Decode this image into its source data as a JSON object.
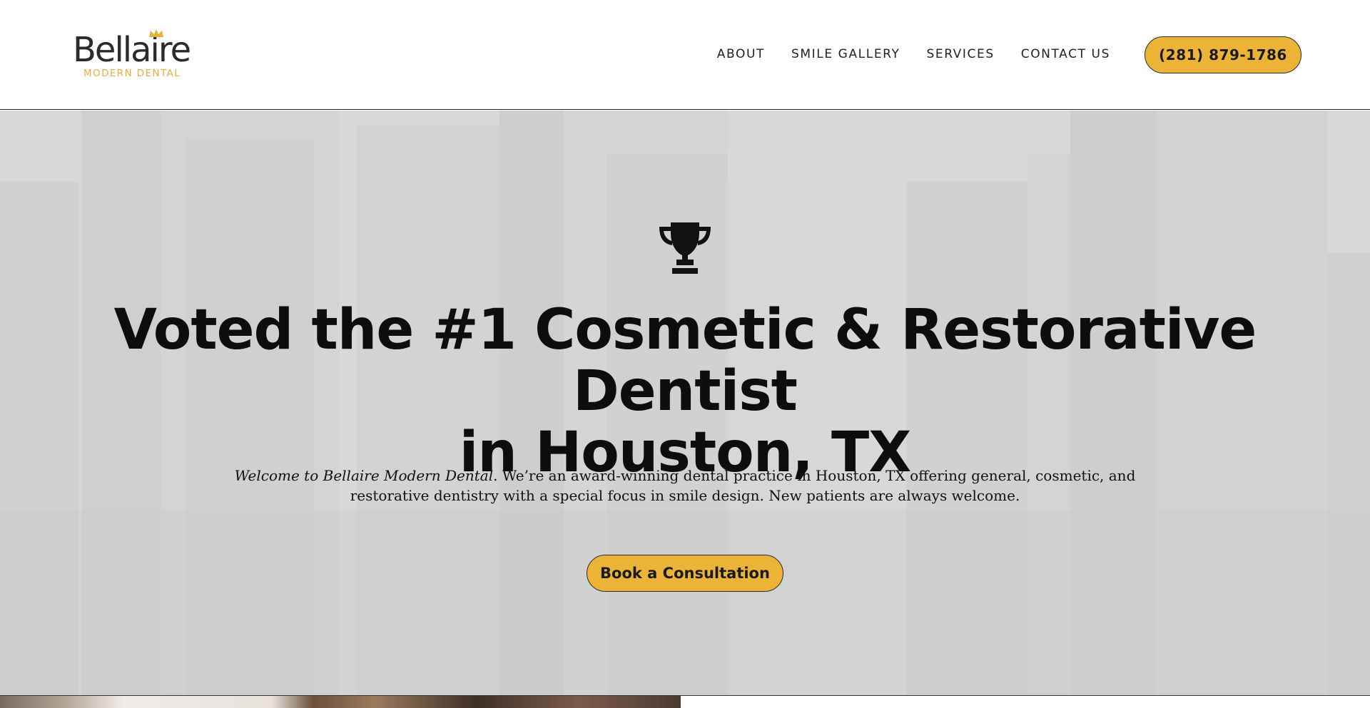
{
  "header": {
    "logo": {
      "word": "Bellaire",
      "subtitle": "MODERN DENTAL"
    },
    "nav": [
      {
        "label": "ABOUT"
      },
      {
        "label": "SMILE GALLERY"
      },
      {
        "label": "SERVICES"
      },
      {
        "label": "CONTACT US"
      }
    ],
    "phone_label": "(281) 879-1786"
  },
  "hero": {
    "icon": "trophy-icon",
    "headline_line1": "Voted the #1 Cosmetic & Restorative Dentist",
    "headline_line2": "in Houston, TX",
    "intro_italic": "Welcome to Bellaire Modern Dental",
    "intro_rest": ". We’re an award-winning dental practice in Houston, TX offering general, cosmetic, and restorative dentistry with a special focus in smile design. New patients are always welcome.",
    "cta_label": "Book a Consultation"
  },
  "colors": {
    "accent": "#ecb437",
    "text": "#111111",
    "logo_text": "#2b2b2b",
    "hero_overlay": "#d6d6d6"
  }
}
